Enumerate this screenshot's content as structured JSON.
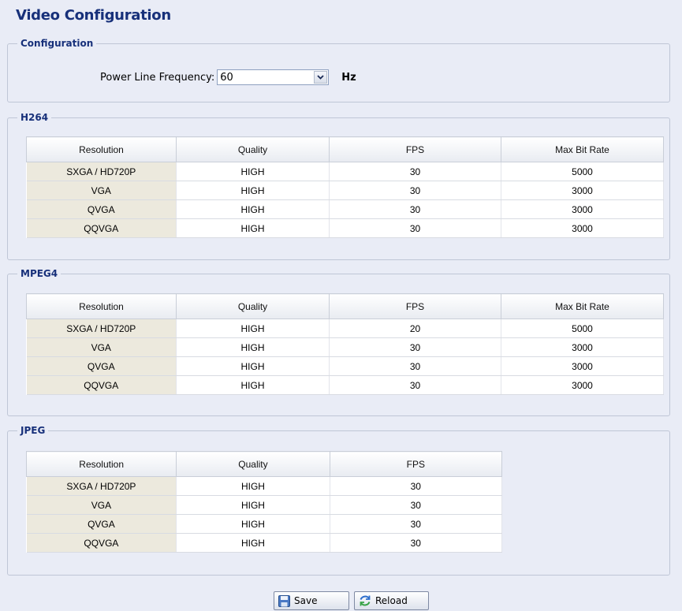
{
  "page": {
    "title": "Video Configuration"
  },
  "configuration": {
    "legend": "Configuration",
    "power_line_label": "Power Line Frequency:",
    "power_line_value": "60",
    "unit": "Hz"
  },
  "columns": {
    "resolution": "Resolution",
    "quality": "Quality",
    "fps": "FPS",
    "max_bit_rate": "Max Bit Rate"
  },
  "h264": {
    "legend": "H264",
    "rows": [
      {
        "resolution": "SXGA / HD720P",
        "quality": "HIGH",
        "fps": "30",
        "max_bit_rate": "5000"
      },
      {
        "resolution": "VGA",
        "quality": "HIGH",
        "fps": "30",
        "max_bit_rate": "3000"
      },
      {
        "resolution": "QVGA",
        "quality": "HIGH",
        "fps": "30",
        "max_bit_rate": "3000"
      },
      {
        "resolution": "QQVGA",
        "quality": "HIGH",
        "fps": "30",
        "max_bit_rate": "3000"
      }
    ]
  },
  "mpeg4": {
    "legend": "MPEG4",
    "rows": [
      {
        "resolution": "SXGA / HD720P",
        "quality": "HIGH",
        "fps": "20",
        "max_bit_rate": "5000"
      },
      {
        "resolution": "VGA",
        "quality": "HIGH",
        "fps": "30",
        "max_bit_rate": "3000"
      },
      {
        "resolution": "QVGA",
        "quality": "HIGH",
        "fps": "30",
        "max_bit_rate": "3000"
      },
      {
        "resolution": "QQVGA",
        "quality": "HIGH",
        "fps": "30",
        "max_bit_rate": "3000"
      }
    ]
  },
  "jpeg": {
    "legend": "JPEG",
    "rows": [
      {
        "resolution": "SXGA / HD720P",
        "quality": "HIGH",
        "fps": "30"
      },
      {
        "resolution": "VGA",
        "quality": "HIGH",
        "fps": "30"
      },
      {
        "resolution": "QVGA",
        "quality": "HIGH",
        "fps": "30"
      },
      {
        "resolution": "QQVGA",
        "quality": "HIGH",
        "fps": "30"
      }
    ]
  },
  "buttons": {
    "save": "Save",
    "reload": "Reload",
    "save_icon": "floppy-disk-icon",
    "reload_icon": "refresh-icon"
  }
}
